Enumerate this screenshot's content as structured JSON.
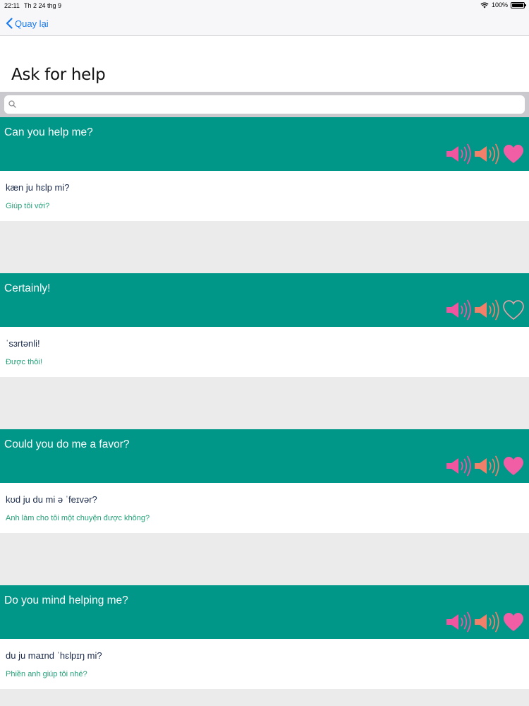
{
  "status": {
    "time": "22:11",
    "date": "Th 2 24 thg 9",
    "battery": "100%"
  },
  "nav": {
    "back_label": "Quay lại"
  },
  "page": {
    "title": "Ask for help"
  },
  "search": {
    "placeholder": "",
    "value": ""
  },
  "colors": {
    "teal": "#009688",
    "pink": "#f0559f",
    "salmon": "#f0806a",
    "heart_pink": "#f25ea5",
    "viet_green": "#25a079",
    "link_blue": "#1a7bf0"
  },
  "icons": [
    "search-icon",
    "chevron-left-icon",
    "speaker-slow-icon",
    "speaker-icon",
    "heart-icon"
  ],
  "phrases": [
    {
      "english": "Can you help me?",
      "phonetic": "kæn ju hɛlp mi?",
      "vietnamese": "Giúp tôi với?",
      "favorite": true
    },
    {
      "english": "Certainly!",
      "phonetic": "ˈsɜrtənli!",
      "vietnamese": "Được thôi!",
      "favorite": false
    },
    {
      "english": "Could you do me a favor?",
      "phonetic": "kʊd ju du mi ə ˈfeɪvər?",
      "vietnamese": "Anh làm cho tôi một chuyện được không?",
      "favorite": true
    },
    {
      "english": "Do you mind helping me?",
      "phonetic": "du ju maɪnd ˈhɛlpɪŋ mi?",
      "vietnamese": "Phiền anh giúp tôi nhé?",
      "favorite": true
    }
  ]
}
